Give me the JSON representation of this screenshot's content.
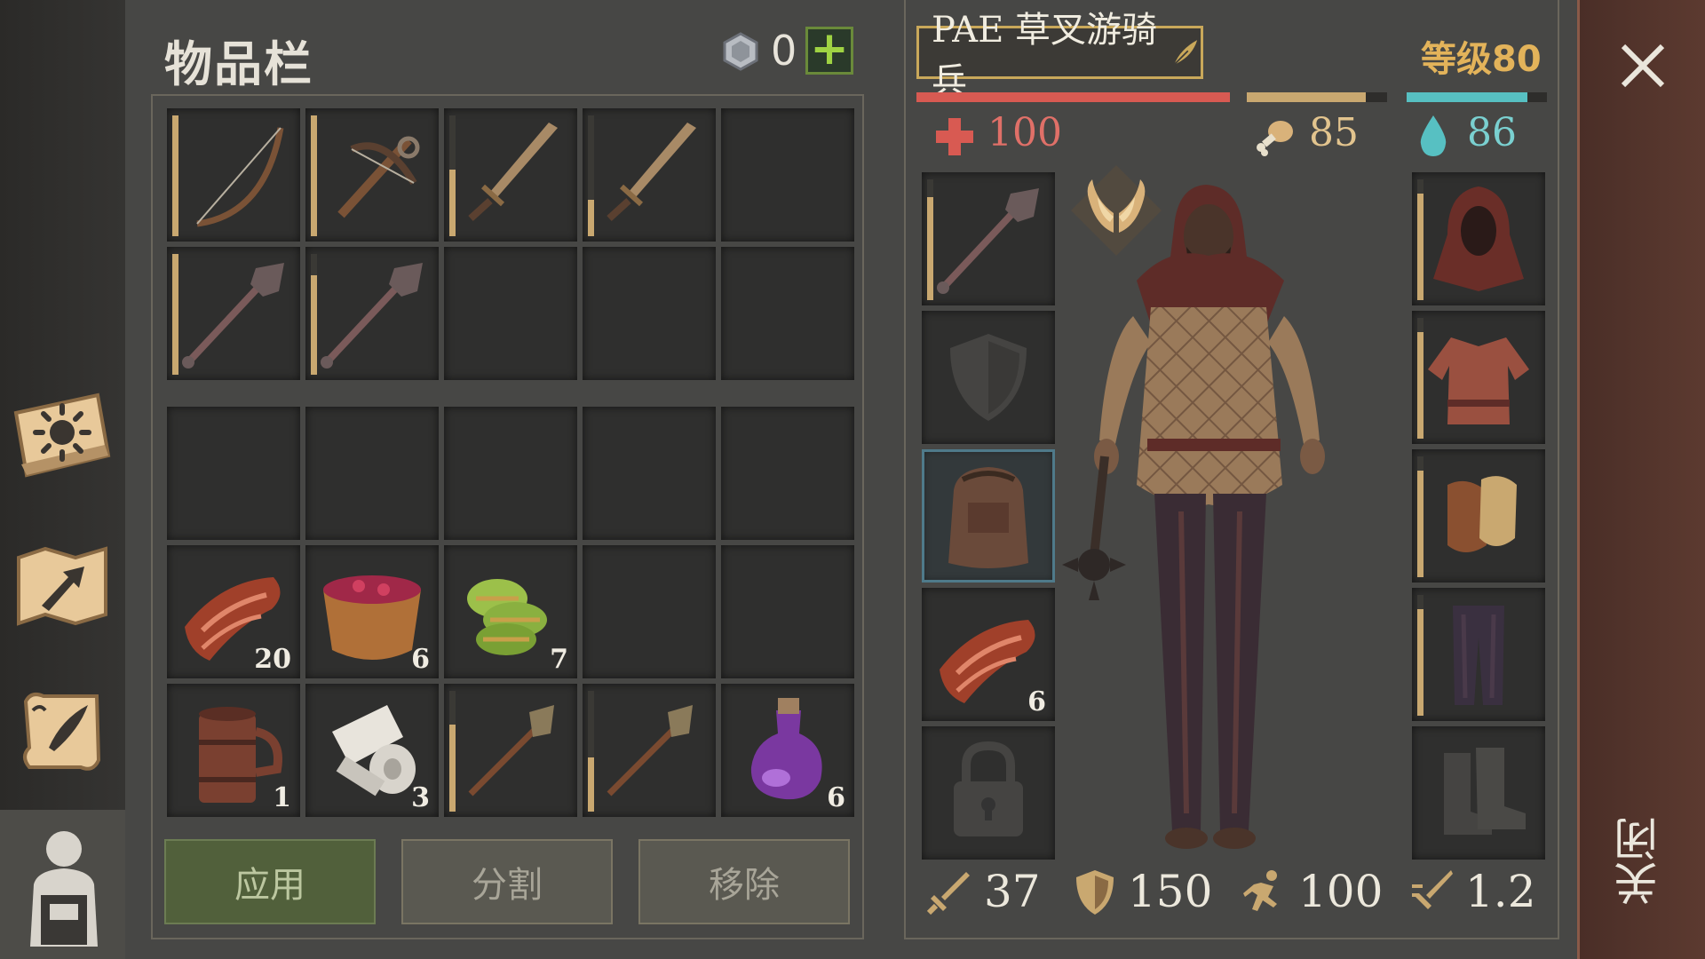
{
  "inventory": {
    "title": "物品栏",
    "currency": "0",
    "grid": [
      {
        "icon": "bow-icon",
        "durability": 1.0,
        "count": ""
      },
      {
        "icon": "crossbow-icon",
        "durability": 1.0,
        "count": ""
      },
      {
        "icon": "sword-icon",
        "durability": 0.55,
        "count": ""
      },
      {
        "icon": "sword-icon",
        "durability": 0.3,
        "count": ""
      },
      null,
      {
        "icon": "mace-icon",
        "durability": 1.0,
        "count": ""
      },
      {
        "icon": "mace-icon",
        "durability": 0.82,
        "count": ""
      },
      null,
      null,
      null,
      null,
      null,
      null,
      null,
      null,
      {
        "icon": "meat-icon",
        "durability": null,
        "count": "20"
      },
      {
        "icon": "berry-bowl-icon",
        "durability": null,
        "count": "6"
      },
      {
        "icon": "herb-icon",
        "durability": null,
        "count": "7"
      },
      null,
      null,
      {
        "icon": "tankard-icon",
        "durability": null,
        "count": "1"
      },
      {
        "icon": "cloth-roll-icon",
        "durability": null,
        "count": "3"
      },
      {
        "icon": "torch-icon",
        "durability": 0.72,
        "count": ""
      },
      {
        "icon": "torch-icon",
        "durability": 0.45,
        "count": ""
      },
      {
        "icon": "potion-icon",
        "durability": null,
        "count": "6"
      }
    ],
    "buttons": {
      "apply": "应用",
      "split": "分割",
      "remove": "移除"
    }
  },
  "character": {
    "name": "PAE 草叉游骑兵",
    "level": "等级80",
    "health": "100",
    "food": "85",
    "water": "86",
    "health_fill": 1.0,
    "food_fill": 0.85,
    "water_fill": 0.86,
    "equip_left": [
      {
        "icon": "mace-icon",
        "durability": 0.85,
        "count": ""
      },
      {
        "icon": "shield-slot-icon",
        "durability": null,
        "count": ""
      },
      {
        "icon": "backpack-icon",
        "durability": null,
        "count": ""
      },
      {
        "icon": "meat-icon",
        "durability": null,
        "count": "6"
      },
      {
        "icon": "lock-icon",
        "durability": null,
        "count": ""
      }
    ],
    "equip_right": [
      {
        "icon": "hood-icon",
        "durability": 0.88,
        "count": ""
      },
      {
        "icon": "tunic-icon",
        "durability": 0.88,
        "count": ""
      },
      {
        "icon": "gloves-icon",
        "durability": 0.88,
        "count": ""
      },
      {
        "icon": "trousers-icon",
        "durability": 0.88,
        "count": ""
      },
      {
        "icon": "boots-slot-icon",
        "durability": null,
        "count": ""
      }
    ],
    "stats": {
      "attack": "37",
      "armor": "150",
      "speed": "100",
      "attack_speed": "1.2"
    },
    "colors": {
      "health": "#d85a52",
      "food": "#c9a870",
      "water": "#57c0c2",
      "level": "#e3b35a"
    }
  },
  "close_label": "关闭"
}
